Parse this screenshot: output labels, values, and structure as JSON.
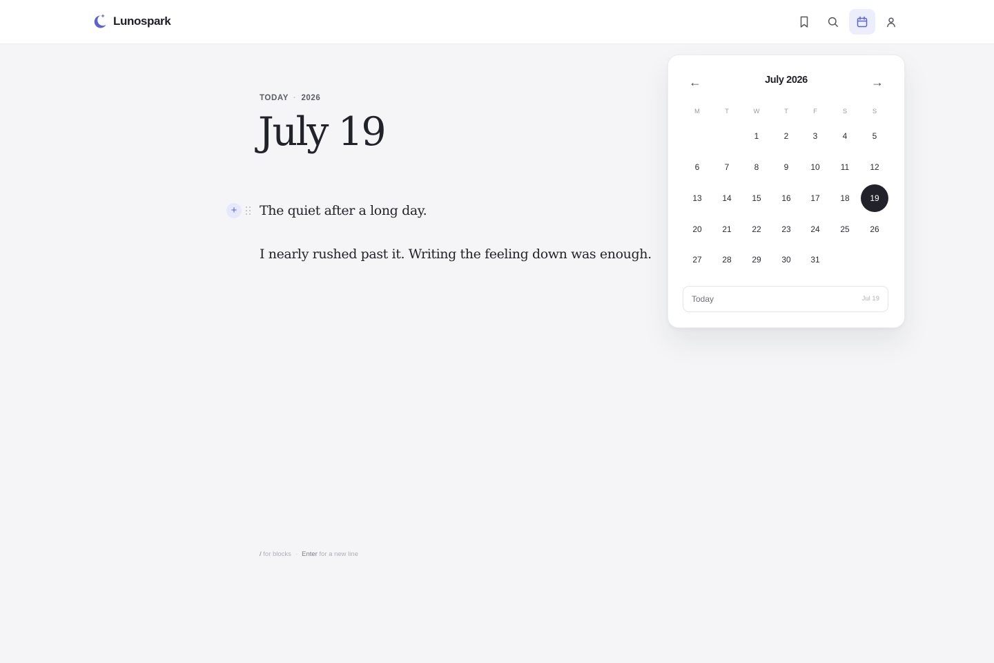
{
  "brand": {
    "name": "Lunospark",
    "icon": "crescent-moon-icon",
    "accent_color": "#5b63d4"
  },
  "header": {
    "actions": [
      {
        "icon": "bookmark-icon",
        "active": false
      },
      {
        "icon": "search-icon",
        "active": false
      },
      {
        "icon": "calendar-icon",
        "active": true
      },
      {
        "icon": "user-icon",
        "active": false
      }
    ]
  },
  "entry": {
    "meta_label": "TODAY",
    "meta_year": "2026",
    "title": "July 19",
    "paragraphs": [
      "The quiet after a long day.",
      "I nearly rushed past it. Writing the feeling down was enough."
    ],
    "add_block_symbol": "+"
  },
  "hint": {
    "slash_key": "/",
    "slash_text": "for blocks",
    "enter_key": "Enter",
    "enter_text": "for a new line"
  },
  "calendar": {
    "month_title": "July 2026",
    "prev_symbol": "←",
    "next_symbol": "→",
    "weekdays": [
      "M",
      "T",
      "W",
      "T",
      "F",
      "S",
      "S"
    ],
    "first_weekday_index": 2,
    "days_in_month": 31,
    "selected_day": 19,
    "today_label": "Today",
    "today_date": "Jul 19"
  }
}
